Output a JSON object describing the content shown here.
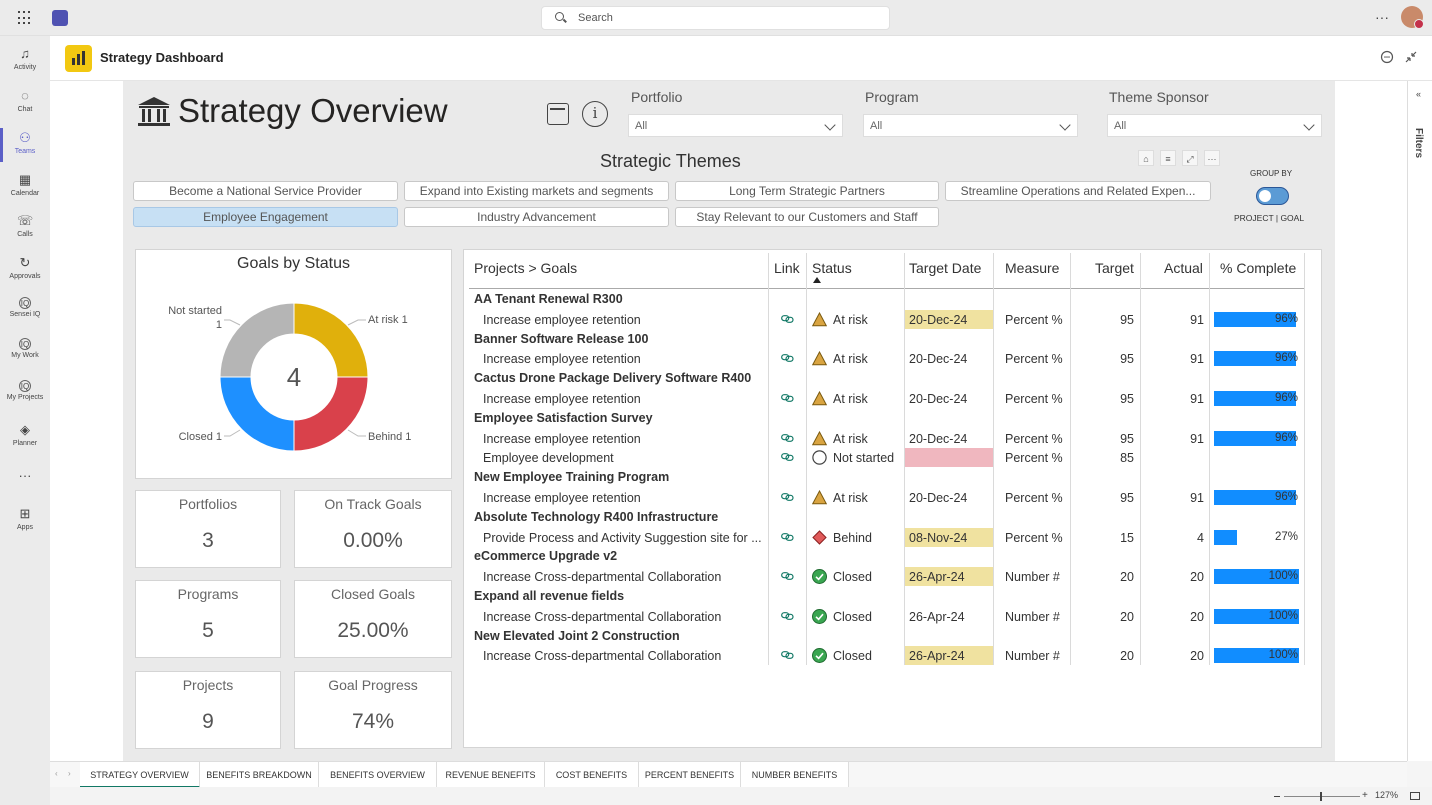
{
  "search": {
    "placeholder": "Search"
  },
  "rail": [
    {
      "label": "Activity",
      "icon": "bell-icon"
    },
    {
      "label": "Chat",
      "icon": "chat-icon"
    },
    {
      "label": "Teams",
      "icon": "teams-icon"
    },
    {
      "label": "Calendar",
      "icon": "calendar-icon"
    },
    {
      "label": "Calls",
      "icon": "phone-icon"
    },
    {
      "label": "Approvals",
      "icon": "approvals-icon"
    },
    {
      "label": "Sensei IQ",
      "icon": "iq-icon"
    },
    {
      "label": "My Work",
      "icon": "iq-icon"
    },
    {
      "label": "My Projects",
      "icon": "iq-icon"
    },
    {
      "label": "Planner",
      "icon": "planner-icon"
    },
    {
      "label": "",
      "icon": "more-icon"
    },
    {
      "label": "Apps",
      "icon": "apps-icon"
    }
  ],
  "app": {
    "title": "Strategy Dashboard"
  },
  "report": {
    "title": "Strategy Overview",
    "filters_label": "Filters",
    "slicers": [
      {
        "label": "Portfolio",
        "value": "All"
      },
      {
        "label": "Program",
        "value": "All"
      },
      {
        "label": "Theme Sponsor",
        "value": "All"
      }
    ],
    "themes_title": "Strategic Themes",
    "themes": [
      "Become a National Service Provider",
      "Expand into Existing markets and segments",
      "Long Term Strategic Partners",
      "Streamline Operations and Related Expen...",
      "Employee Engagement",
      "Industry Advancement",
      "Stay Relevant to our Customers and Staff"
    ],
    "selected_theme": "Employee Engagement",
    "group_by": {
      "label": "GROUP BY",
      "options": "PROJECT | GOAL"
    }
  },
  "chart_data": {
    "type": "pie",
    "title": "Goals by Status",
    "center_label": "4",
    "categories": [
      "At risk",
      "Behind",
      "Closed",
      "Not started"
    ],
    "values": [
      1,
      1,
      1,
      1
    ],
    "labels": [
      "At risk 1",
      "Behind 1",
      "Closed 1",
      "Not started\n1"
    ],
    "colors": [
      "#e0b00c",
      "#d9414b",
      "#1e90ff",
      "#b5b5b5"
    ]
  },
  "cards": [
    {
      "title": "Portfolios",
      "value": "3"
    },
    {
      "title": "On Track Goals",
      "value": "0.00%"
    },
    {
      "title": "Programs",
      "value": "5"
    },
    {
      "title": "Closed Goals",
      "value": "25.00%"
    },
    {
      "title": "Projects",
      "value": "9"
    },
    {
      "title": "Goal Progress",
      "value": "74%"
    }
  ],
  "table": {
    "headers": [
      "Projects > Goals",
      "Link",
      "Status",
      "Target Date",
      "Measure",
      "Target",
      "Actual",
      "% Complete"
    ],
    "rows": [
      {
        "type": "project",
        "name": "AA Tenant Renewal R300"
      },
      {
        "type": "goal",
        "name": "Increase employee retention",
        "status": "At risk",
        "status_icon": "warning-icon",
        "date": "20-Dec-24",
        "date_hl": "yellow",
        "measure": "Percent %",
        "target": "95",
        "actual": "91",
        "pct": "96%",
        "pct_val": 0.96
      },
      {
        "type": "project",
        "name": "Banner Software Release 100"
      },
      {
        "type": "goal",
        "name": "Increase employee retention",
        "status": "At risk",
        "status_icon": "warning-icon",
        "date": "20-Dec-24",
        "date_hl": "",
        "measure": "Percent %",
        "target": "95",
        "actual": "91",
        "pct": "96%",
        "pct_val": 0.96
      },
      {
        "type": "project",
        "name": "Cactus Drone Package Delivery Software R400"
      },
      {
        "type": "goal",
        "name": "Increase employee retention",
        "status": "At risk",
        "status_icon": "warning-icon",
        "date": "20-Dec-24",
        "date_hl": "",
        "measure": "Percent %",
        "target": "95",
        "actual": "91",
        "pct": "96%",
        "pct_val": 0.96
      },
      {
        "type": "project",
        "name": "Employee Satisfaction Survey"
      },
      {
        "type": "goal",
        "name": "Increase employee retention",
        "status": "At risk",
        "status_icon": "warning-icon",
        "date": "20-Dec-24",
        "date_hl": "",
        "measure": "Percent %",
        "target": "95",
        "actual": "91",
        "pct": "96%",
        "pct_val": 0.96
      },
      {
        "type": "goal",
        "name": "Employee development",
        "status": "Not started",
        "status_icon": "circle-icon",
        "date": "",
        "date_hl": "pink",
        "measure": "Percent %",
        "target": "85",
        "actual": "",
        "pct": "",
        "pct_val": 0
      },
      {
        "type": "project",
        "name": "New Employee Training Program"
      },
      {
        "type": "goal",
        "name": "Increase employee retention",
        "status": "At risk",
        "status_icon": "warning-icon",
        "date": "20-Dec-24",
        "date_hl": "",
        "measure": "Percent %",
        "target": "95",
        "actual": "91",
        "pct": "96%",
        "pct_val": 0.96
      },
      {
        "type": "project",
        "name": "Absolute Technology R400 Infrastructure"
      },
      {
        "type": "goal",
        "name": "Provide Process and Activity Suggestion site for ...",
        "status": "Behind",
        "status_icon": "diamond-icon",
        "date": "08-Nov-24",
        "date_hl": "yellow",
        "measure": "Percent %",
        "target": "15",
        "actual": "4",
        "pct": "27%",
        "pct_val": 0.27
      },
      {
        "type": "project",
        "name": "eCommerce Upgrade v2"
      },
      {
        "type": "goal",
        "name": "Increase Cross-departmental Collaboration",
        "status": "Closed",
        "status_icon": "check-circle-icon",
        "date": "26-Apr-24",
        "date_hl": "yellow",
        "measure": "Number #",
        "target": "20",
        "actual": "20",
        "pct": "100%",
        "pct_val": 1.0
      },
      {
        "type": "project",
        "name": "Expand all revenue fields"
      },
      {
        "type": "goal",
        "name": "Increase Cross-departmental Collaboration",
        "status": "Closed",
        "status_icon": "check-circle-icon",
        "date": "26-Apr-24",
        "date_hl": "",
        "measure": "Number #",
        "target": "20",
        "actual": "20",
        "pct": "100%",
        "pct_val": 1.0
      },
      {
        "type": "project",
        "name": "New Elevated Joint 2 Construction"
      },
      {
        "type": "goal",
        "name": "Increase Cross-departmental Collaboration",
        "status": "Closed",
        "status_icon": "check-circle-icon",
        "date": "26-Apr-24",
        "date_hl": "yellow",
        "measure": "Number #",
        "target": "20",
        "actual": "20",
        "pct": "100%",
        "pct_val": 1.0
      }
    ]
  },
  "tabs": [
    "STRATEGY OVERVIEW",
    "BENEFITS BREAKDOWN",
    "BENEFITS OVERVIEW",
    "REVENUE BENEFITS",
    "COST BENEFITS",
    "PERCENT BENEFITS",
    "NUMBER BENEFITS"
  ],
  "active_tab": "STRATEGY OVERVIEW",
  "zoom": "127%"
}
